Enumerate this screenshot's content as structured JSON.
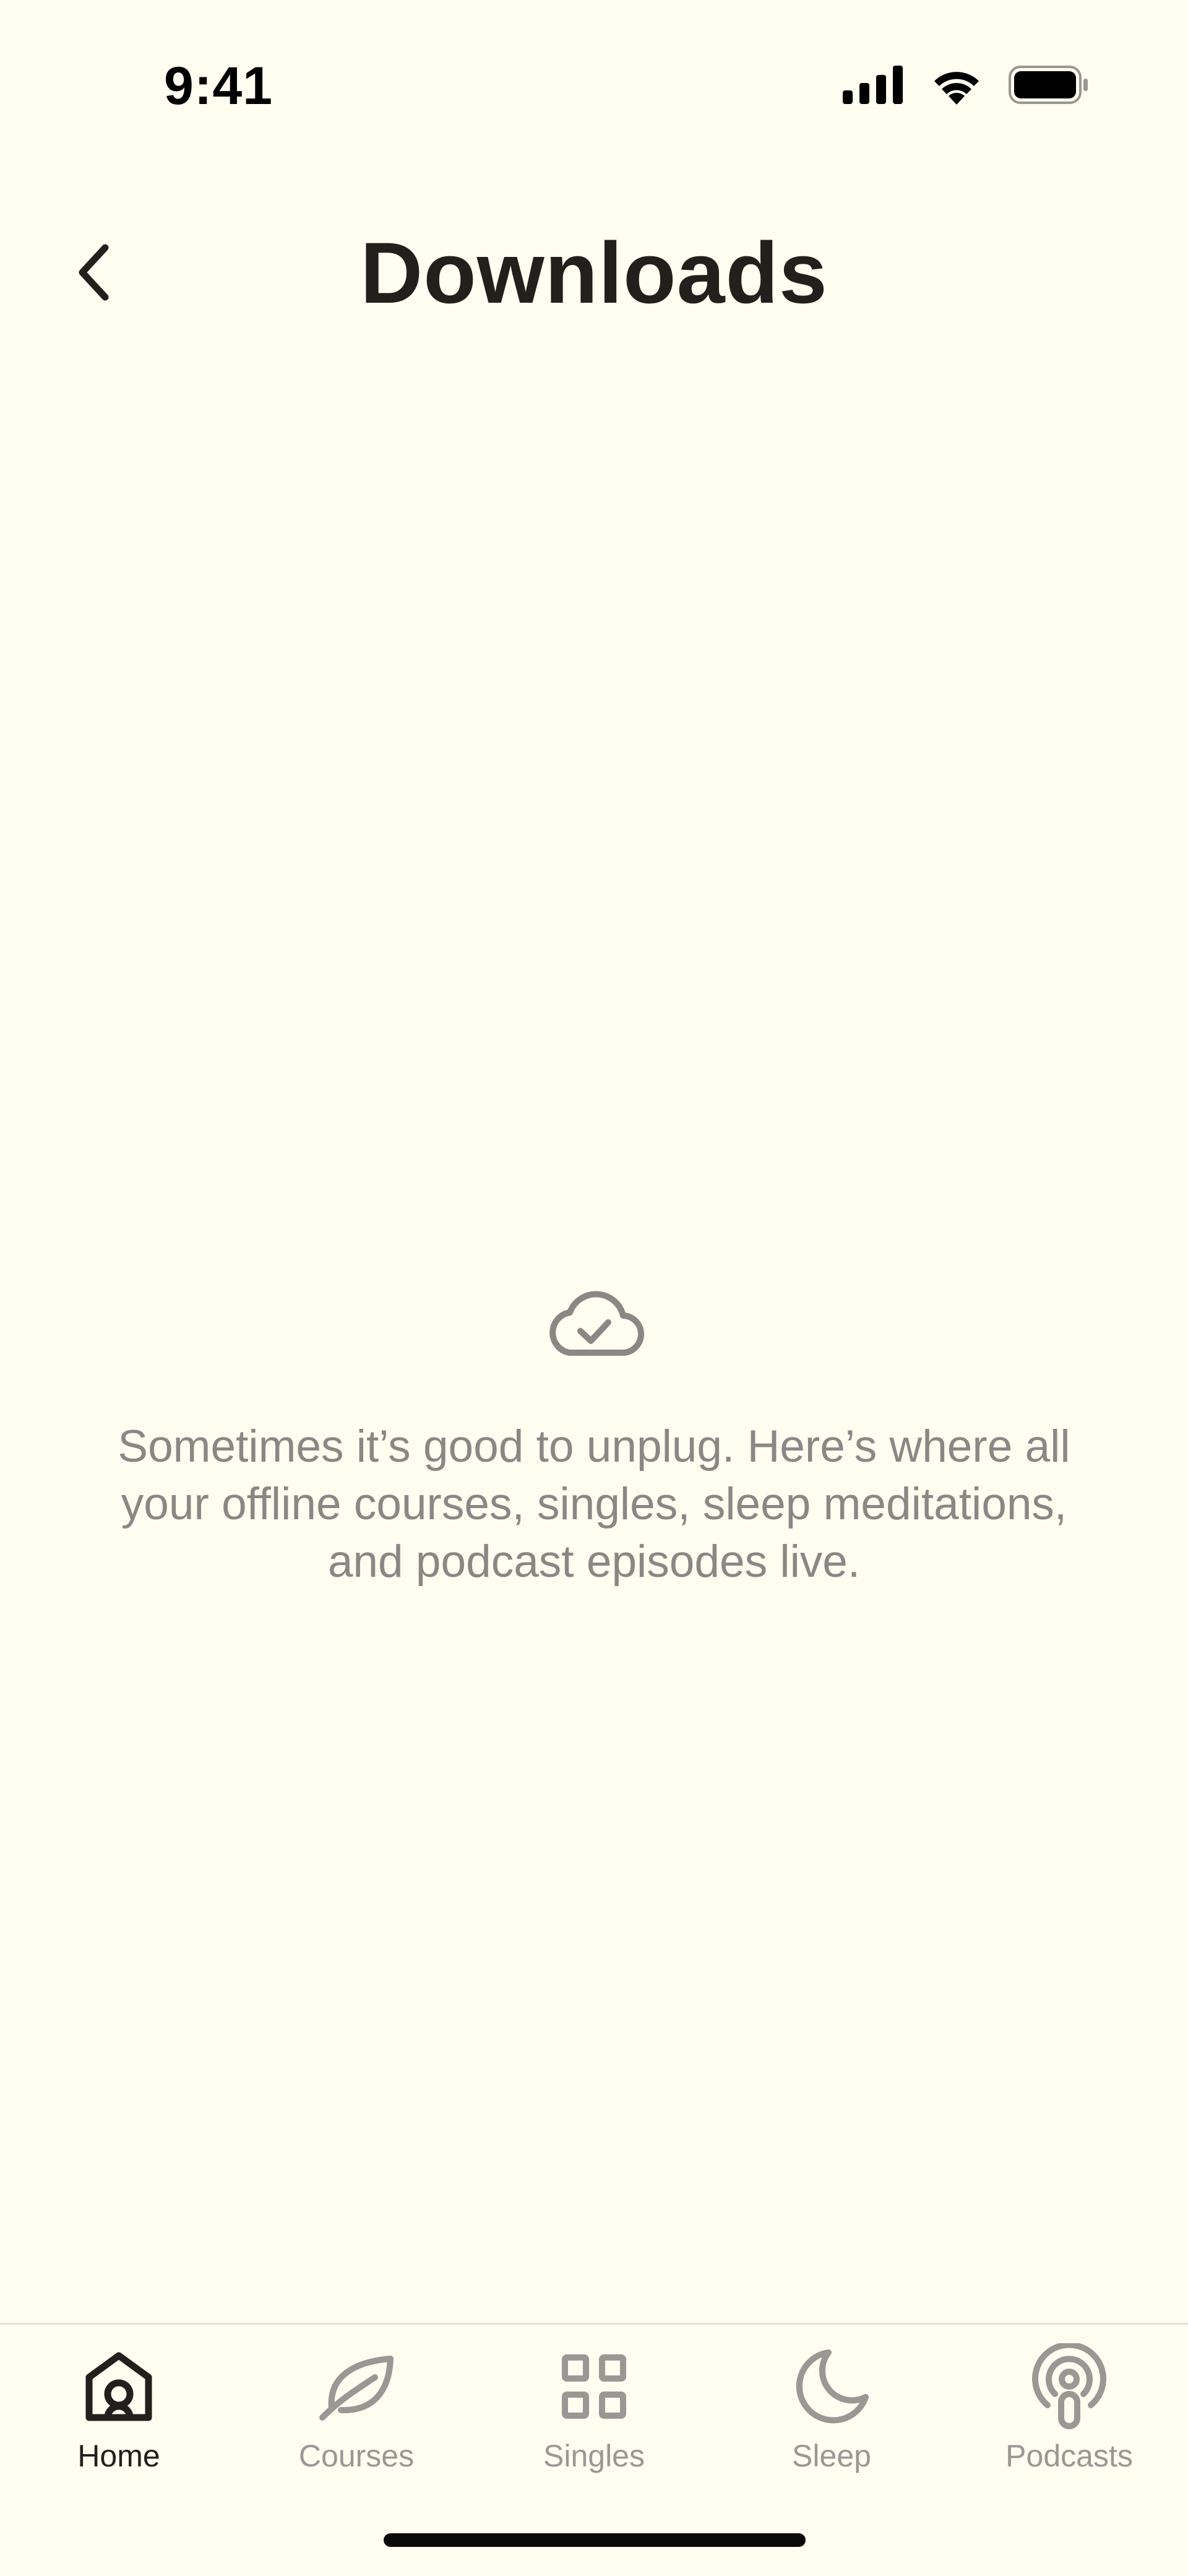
{
  "status_bar": {
    "time": "9:41"
  },
  "header": {
    "title": "Downloads"
  },
  "empty_state": {
    "icon": "cloud-check-icon",
    "message": "Sometimes it’s good to unplug. Here’s where all your offline courses, singles, sleep meditations, and podcast episodes live."
  },
  "tab_bar": {
    "items": [
      {
        "label": "Home",
        "icon": "home-icon",
        "active": true
      },
      {
        "label": "Courses",
        "icon": "leaf-icon",
        "active": false
      },
      {
        "label": "Singles",
        "icon": "grid-icon",
        "active": false
      },
      {
        "label": "Sleep",
        "icon": "moon-icon",
        "active": false
      },
      {
        "label": "Podcasts",
        "icon": "podcast-icon",
        "active": false
      }
    ]
  },
  "colors": {
    "background": "#FFFCF0",
    "text_primary": "#231F1C",
    "text_secondary": "#8A8784",
    "tab_inactive": "#9A9794"
  }
}
